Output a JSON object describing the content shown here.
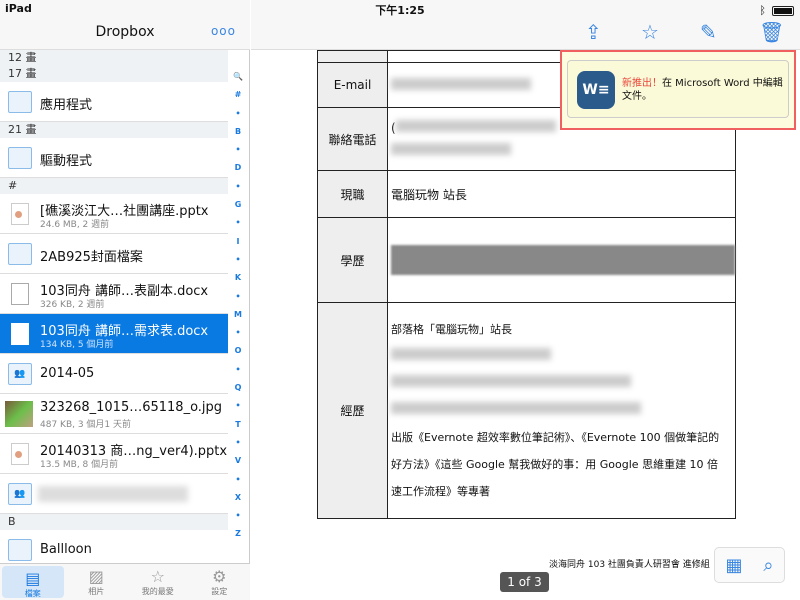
{
  "status": {
    "device": "iPad",
    "time": "下午1:25"
  },
  "sidebar": {
    "title": "Dropbox",
    "more": "ooo",
    "sections": [
      {
        "header": "12 畫"
      },
      {
        "header": "17 畫",
        "rows": [
          {
            "name": "應用程式",
            "type": "folder"
          }
        ]
      },
      {
        "header": "21 畫",
        "rows": [
          {
            "name": "驅動程式",
            "type": "folder"
          }
        ]
      },
      {
        "header": "#",
        "rows": [
          {
            "name": "[礁溪淡江大…社團講座.pptx",
            "meta": "24.6 MB, 2 週前",
            "type": "pptx"
          },
          {
            "name": "2AB925封面檔案",
            "type": "folder"
          },
          {
            "name": "103同舟 講師…表副本.docx",
            "meta": "326 KB, 2 週前",
            "type": "docx"
          },
          {
            "name": "103同舟 講師…需求表.docx",
            "meta": "134 KB, 5 個月前",
            "type": "docx",
            "selected": true
          },
          {
            "name": "2014-05",
            "type": "shared-folder"
          },
          {
            "name": "323268_1015…65118_o.jpg",
            "meta": "487 KB, 3 個月1 天前",
            "type": "photo"
          },
          {
            "name": "20140313 商…ng_ver4).pptx",
            "meta": "13.5 MB, 8 個月前",
            "type": "pptx"
          },
          {
            "name": "",
            "type": "shared-folder",
            "blurred": true
          }
        ]
      },
      {
        "header": "B",
        "rows": [
          {
            "name": "Ballloon",
            "type": "folder"
          }
        ]
      }
    ],
    "index": [
      "🔍",
      "#",
      "•",
      "B",
      "•",
      "D",
      "•",
      "G",
      "•",
      "I",
      "•",
      "K",
      "•",
      "M",
      "•",
      "O",
      "•",
      "Q",
      "•",
      "T",
      "•",
      "V",
      "•",
      "X",
      "•",
      "Z"
    ],
    "tabs": [
      {
        "label": "檔案",
        "icon": "file-icon",
        "active": true
      },
      {
        "label": "相片",
        "icon": "photo-icon"
      },
      {
        "label": "我的最愛",
        "icon": "star-icon"
      },
      {
        "label": "設定",
        "icon": "gear-icon"
      }
    ]
  },
  "toolbar": {
    "icons": [
      "share-icon",
      "star-icon",
      "edit-icon",
      "trash-icon"
    ]
  },
  "popover": {
    "highlight": "新推出！",
    "text": "在 Microsoft Word 中編輯文件。",
    "accent": "#e8463a"
  },
  "document": {
    "rows": [
      {
        "label": "E-mail"
      },
      {
        "label": "聯絡電話",
        "value": "("
      },
      {
        "label": "現職",
        "value": "電腦玩物  站長"
      },
      {
        "label": "學歷"
      },
      {
        "label": "經歷",
        "lines": [
          "部落格「電腦玩物」站長",
          "出版《Evernote 超效率數位筆記術》、《Evernote 100 個做筆記的",
          "好方法》《這些 Google 幫我做好的事：用 Google 思維重建 10 倍",
          "速工作流程》等專著"
        ]
      }
    ],
    "footer": "淡海同舟  103 社團負責人研習會  進修組",
    "page": "1 of 3"
  }
}
